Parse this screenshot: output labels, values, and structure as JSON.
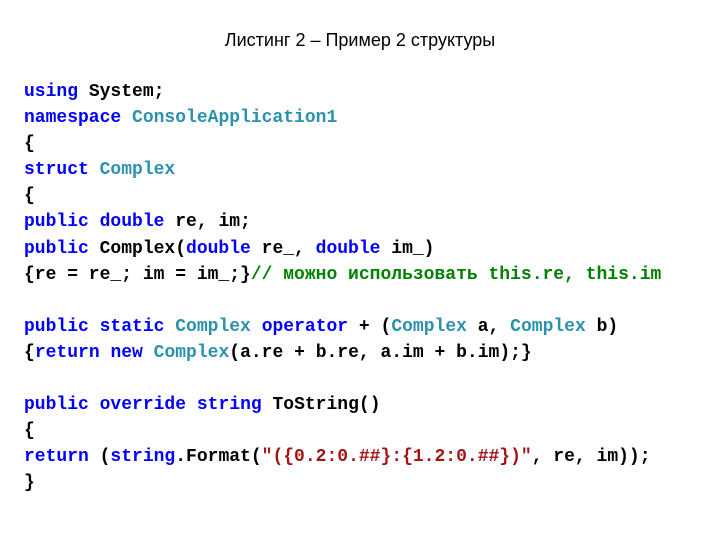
{
  "title": "Листинг 2 – Пример 2 структуры",
  "code": {
    "l1_kw1": "using",
    "l1_rest": " System;",
    "l2_kw1": "namespace",
    "l2_rest": " ",
    "l2_type": "ConsoleApplication1",
    "l3": "{",
    "l4_kw1": "struct",
    "l4_rest": " ",
    "l4_type": "Complex",
    "l5": "{",
    "l6_kw1": "public",
    "l6_sp1": " ",
    "l6_kw2": "double",
    "l6_rest": " re, im;",
    "l7_kw1": "public",
    "l7_rest1": " Complex(",
    "l7_kw2": "double",
    "l7_rest2": " re_, ",
    "l7_kw3": "double",
    "l7_rest3": " im_)",
    "l8_part1": "{re = re_; im = im_;}",
    "l8_comment": "// можно использовать this.re, this.im",
    "l9": "",
    "l10_kw1": "public",
    "l10_sp1": " ",
    "l10_kw2": "static",
    "l10_rest1": " ",
    "l10_type": "Complex",
    "l10_rest2": " ",
    "l10_kw3": "operator",
    "l10_rest3": " + (",
    "l10_type2": "Complex",
    "l10_rest4": " a, ",
    "l10_type3": "Complex",
    "l10_rest5": " b)",
    "l11_part1": "{",
    "l11_kw1": "return",
    "l11_sp1": " ",
    "l11_kw2": "new",
    "l11_rest1": " ",
    "l11_type": "Complex",
    "l11_rest2": "(a.re + b.re, a.im + b.im);}",
    "l12": "",
    "l13_kw1": "public",
    "l13_sp1": " ",
    "l13_kw2": "override",
    "l13_sp2": " ",
    "l13_kw3": "string",
    "l13_rest": " ToString()",
    "l14": "{",
    "l15_kw1": "return",
    "l15_rest1": " (",
    "l15_kw2": "string",
    "l15_rest2": ".Format(",
    "l15_str": "\"({0.2:0.##}:{1.2:0.##})\"",
    "l15_rest3": ", re, im));",
    "l16": "}"
  }
}
